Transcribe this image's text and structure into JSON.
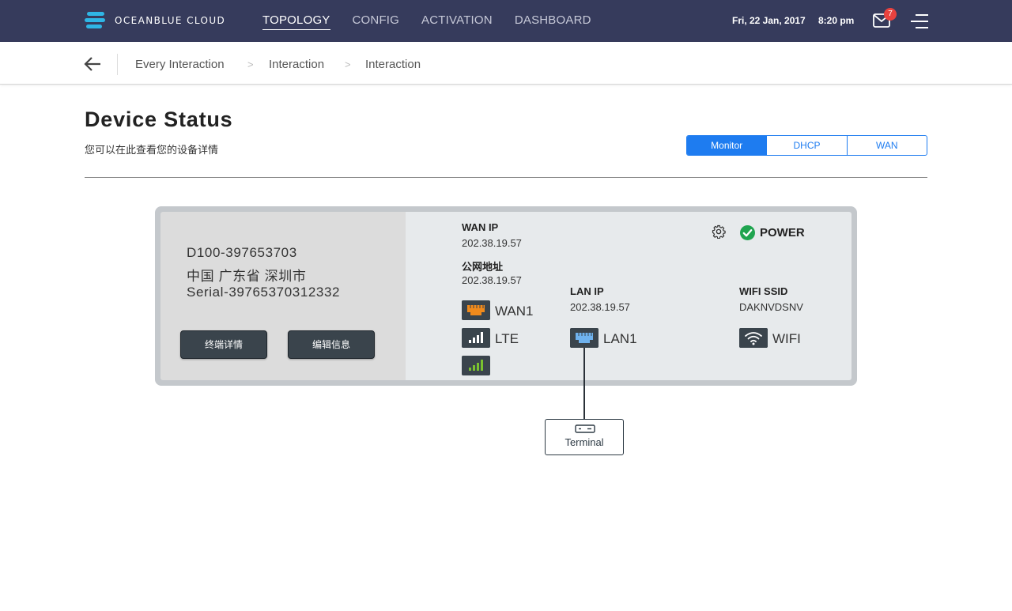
{
  "header": {
    "brand": "OCEANBLUE CLOUD",
    "nav": [
      "TOPOLOGY",
      "CONFIG",
      "ACTIVATION",
      "DASHBOARD"
    ],
    "active_nav": "TOPOLOGY",
    "date": "Fri, 22 Jan, 2017",
    "time": "8:20 pm",
    "mail_count": "7"
  },
  "breadcrumb": [
    "Every Interaction",
    "Interaction",
    "Interaction"
  ],
  "page": {
    "title": "Device Status",
    "subtitle": "您可以在此查看您的设备详情",
    "tabs": [
      "Monitor",
      "DHCP",
      "WAN"
    ],
    "active_tab": "Monitor"
  },
  "device": {
    "id": "D100-397653703",
    "location": "中国 广东省 深圳市",
    "serial": "Serial-39765370312332",
    "btn_terminal": "终端详情",
    "btn_edit": "编辑信息"
  },
  "status": {
    "wan_ip_label": "WAN IP",
    "wan_ip": "202.38.19.57",
    "public_label": "公网地址",
    "public_ip": "202.38.19.57",
    "lan_ip_label": "LAN IP",
    "lan_ip": "202.38.19.57",
    "wifi_ssid_label": "WIFI SSID",
    "wifi_ssid": "DAKNVDSNV",
    "power": "POWER",
    "ports": {
      "wan1": "WAN1",
      "lte": "LTE",
      "lan1": "LAN1",
      "wifi": "WIFI"
    }
  },
  "terminal": {
    "label": "Terminal"
  },
  "colors": {
    "nav_bg": "#363b5c",
    "accent": "#1e7cf0",
    "wan_port": "#f08a1c",
    "lan_port": "#6fb2ee",
    "signal_green": "#7ac22f",
    "power_ok": "#1fa44f"
  }
}
